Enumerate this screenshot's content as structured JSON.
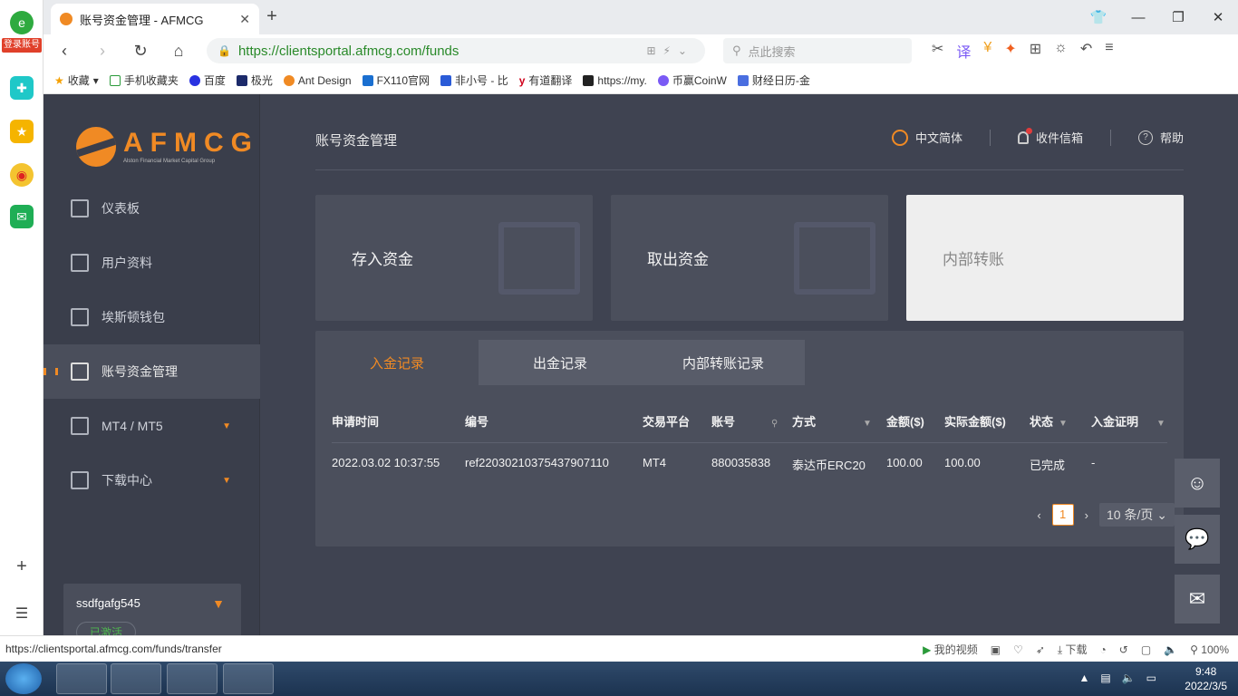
{
  "browser": {
    "login_badge": "登录账号",
    "tab_title": "账号资金管理 - AFMCG",
    "url": "https://clientsportal.afmcg.com/funds",
    "search_placeholder": "点此搜索",
    "bookmarks": [
      "收藏",
      "手机收藏夹",
      "百度",
      "极光",
      "Ant Design",
      "FX110官网",
      "非小号 - 比",
      "有道翻译",
      "https://my.",
      "币赢CoinW",
      "财经日历-金"
    ]
  },
  "portal": {
    "brand": "AFMCG",
    "brand_sub": "Alston Financial Market Capital Group",
    "nav": [
      "仪表板",
      "用户资料",
      "埃斯顿钱包",
      "账号资金管理",
      "MT4 / MT5",
      "下载中心"
    ],
    "username": "ssdfgafg545",
    "user_status": "已激活",
    "page_title": "账号资金管理",
    "lang": "中文简体",
    "inbox": "收件信箱",
    "help": "帮助",
    "cards": [
      "存入资金",
      "取出资金",
      "内部转账"
    ],
    "tabs": [
      "入金记录",
      "出金记录",
      "内部转账记录"
    ],
    "columns": [
      "申请时间",
      "编号",
      "交易平台",
      "账号",
      "方式",
      "金额($)",
      "实际金额($)",
      "状态",
      "入金证明"
    ],
    "rows": [
      [
        "2022.03.02 10:37:55",
        "ref22030210375437907110",
        "MT4",
        "880035838",
        "泰达币ERC20",
        "100.00",
        "100.00",
        "已完成",
        "-"
      ]
    ],
    "page_current": "1",
    "page_size": "10 条/页"
  },
  "status": {
    "hover_url": "https://clientsportal.afmcg.com/funds/transfer",
    "video": "我的视频",
    "download": "下载",
    "zoom": "100%"
  },
  "taskbar": {
    "time": "9:48",
    "date": "2022/3/5"
  },
  "colors": {
    "accent": "#f08a24",
    "portal_bg": "#3f4351",
    "sidebar_bg": "#3a3e4b"
  }
}
